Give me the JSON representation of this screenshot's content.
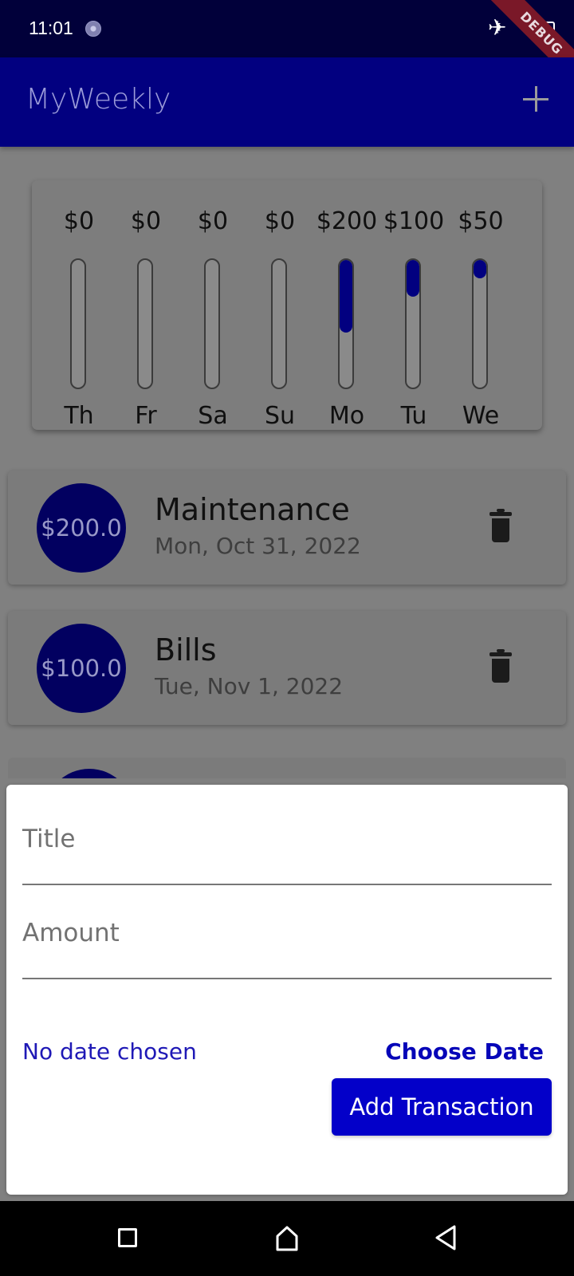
{
  "status": {
    "time": "11:01",
    "debug_label": "DEBUG"
  },
  "appbar": {
    "title": "MyWeekly",
    "add_icon": "plus-icon"
  },
  "chart_data": {
    "type": "bar",
    "title": "",
    "xlabel": "",
    "ylabel": "",
    "categories": [
      "Th",
      "Fr",
      "Sa",
      "Su",
      "Mo",
      "Tu",
      "We"
    ],
    "amount_labels": [
      "$0",
      "$0",
      "$0",
      "$0",
      "$200",
      "$100",
      "$50"
    ],
    "values": [
      0,
      0,
      0,
      0,
      200,
      100,
      50
    ],
    "ylim": [
      0,
      350
    ]
  },
  "transactions": [
    {
      "amount": "$200.0",
      "title": "Maintenance",
      "date": "Mon, Oct 31, 2022"
    },
    {
      "amount": "$100.0",
      "title": "Bills",
      "date": "Tue, Nov 1, 2022"
    }
  ],
  "form": {
    "title_label": "Title",
    "amount_label": "Amount",
    "title_value": "",
    "amount_value": "",
    "no_date_text": "No date chosen",
    "choose_date_label": "Choose Date",
    "submit_label": "Add Transaction"
  },
  "colors": {
    "primary": "#020080",
    "accent": "#0300c9",
    "link": "#0605b8"
  }
}
